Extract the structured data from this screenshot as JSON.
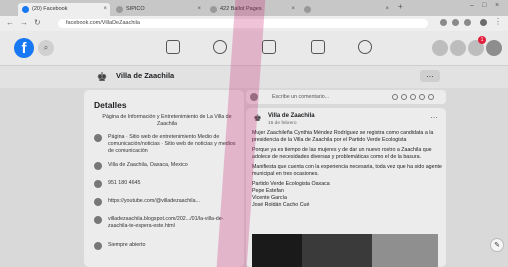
{
  "browser": {
    "tabs": [
      {
        "label": "(20) Facebook"
      },
      {
        "label": "SIPICO"
      },
      {
        "label": "422 Ballot Pages"
      },
      {
        "label": ""
      }
    ],
    "url": "facebook.com/VillaDeZaachila"
  },
  "fb": {
    "logo": "f",
    "notification_count": "1"
  },
  "page": {
    "name": "Villa de Zaachila",
    "menu": "…"
  },
  "details": {
    "heading": "Detalles",
    "intro": "Página de Información y Entretenimiento de La Villa de Zaachila",
    "rows": [
      {
        "icon": "info-icon",
        "text": "Página · Sitio web de entretenimiento Medio de comunicación/noticias · Sitio web de noticias y medios de comunicación"
      },
      {
        "icon": "location-icon",
        "text": "Villa de Zaachila, Oaxaca, Mexico"
      },
      {
        "icon": "phone-icon",
        "text": "951 180 4645"
      },
      {
        "icon": "link-icon",
        "text": "https://youtube.com/@villadezaachila..."
      },
      {
        "icon": "link-icon",
        "text": "villadezaachila.blogspot.com/202.../01/la-villa-de-zaachila-te-espera-este.html"
      },
      {
        "icon": "clock-icon",
        "text": "Siempre abierto"
      }
    ]
  },
  "composer": {
    "placeholder": "Escribe un comentario..."
  },
  "post": {
    "author": "Villa de Zaachila",
    "time": "16 de febrero",
    "dots": "…",
    "paragraphs": [
      "Mujer Zaachileña Cynthia Méndez Rodríguez se registra como candidata a la presidencia de la Villa de Zaachila por el Partido Verde Ecologista",
      "Porque ya es tiempo de las mujeres y de dar un nuevo rostro a Zaachila que adolece de necesidades diversas y problemáticas como el de la basura.",
      "Manifiesta que cuenta con la experiencia necesaria, toda vez que ha sido agente municipal en tres ocasiones.",
      "Partido Verde Ecologista Oaxaca\nPepe Estefan\nVicente García\nJosé Roldán Cacho Cué"
    ]
  },
  "colors": {
    "facebook_blue": "#1877f2",
    "annotation_mark": "#c82878",
    "badge_red": "#e41e3f"
  }
}
